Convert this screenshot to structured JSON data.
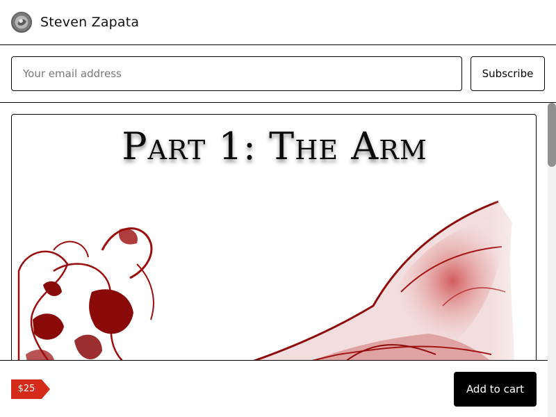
{
  "header": {
    "avatar_icon": "creator-avatar",
    "creator_name": "Steven Zapata"
  },
  "subscribe": {
    "email_placeholder": "Your email address",
    "email_value": "",
    "button_label": "Subscribe"
  },
  "product": {
    "cover_title": "Part 1: The Arm",
    "cover_image": "red-ink-arm-sketch"
  },
  "purchase": {
    "price": "$25",
    "add_to_cart_label": "Add to cart"
  },
  "colors": {
    "price_tag": "#d42a1a",
    "button_dark": "#000000",
    "sketch_red": "#9c0c0c"
  }
}
